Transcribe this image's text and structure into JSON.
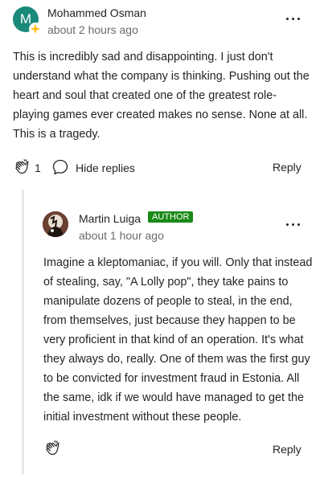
{
  "comment": {
    "avatar_letter": "M",
    "author": "Mohammed Osman",
    "timestamp": "about 2 hours ago",
    "text": "This is incredibly sad and disappointing. I just don't understand what the company is thinking. Pushing out the heart and soul that created one of the greatest role-playing games ever created makes no sense. None at all. This is a tragedy.",
    "clap_count": "1",
    "hide_replies_label": "Hide replies",
    "reply_label": "Reply"
  },
  "reply": {
    "author": "Martin Luiga",
    "badge": "AUTHOR",
    "timestamp": "about 1 hour ago",
    "text": "Imagine a kleptomaniac, if you will. Only that instead of stealing, say, \"A Lolly pop\", they take pains to manipulate dozens of people to steal, in the end, from themselves, just because they happen to be very proficient in that kind of an operation. It's what they always do, really. One of them was the first guy to be convicted for investment fraud in Estonia. All the same, idk if we would have managed to get the initial investment without these people.",
    "reply_label": "Reply"
  },
  "colors": {
    "avatar_teal": "#1a8a7a",
    "author_badge_green": "#1a8917",
    "star_badge": "#ffc017",
    "thread_line": "#e6e6e6",
    "muted_text": "#6b6b6b"
  },
  "icons": {
    "clap": "clap-icon",
    "comment": "speech-bubble-icon",
    "more": "more-horizontal-icon",
    "member_star": "star-icon"
  }
}
